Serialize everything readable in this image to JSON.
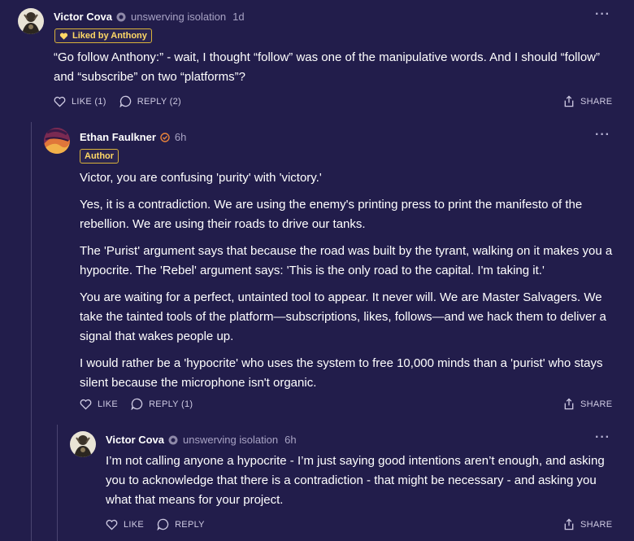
{
  "comments": [
    {
      "author": "Victor Cova",
      "subtitle": "unswerving isolation",
      "time": "1d",
      "badge": "Liked by Anthony",
      "paragraphs": [
        "“Go follow Anthony:” - wait, I thought “follow” was one of the manipulative words. And I should “follow” and “subscribe” on two “platforms”?"
      ],
      "like_label": "LIKE (1)",
      "reply_label": "REPLY (2)",
      "share_label": "SHARE"
    },
    {
      "author": "Ethan Faulkner",
      "time": "6h",
      "badge": "Author",
      "paragraphs": [
        "Victor, you are confusing 'purity' with 'victory.'",
        "Yes, it is a contradiction. We are using the enemy's printing press to print the manifesto of the rebellion. We are using their roads to drive our tanks.",
        "The 'Purist' argument says that because the road was built by the tyrant, walking on it makes you a hypocrite. The 'Rebel' argument says: 'This is the only road to the capital. I'm taking it.'",
        "You are waiting for a perfect, untainted tool to appear. It never will. We are Master Salvagers. We take the tainted tools of the platform—subscriptions, likes, follows—and we hack them to deliver a signal that wakes people up.",
        "I would rather be a 'hypocrite' who uses the system to free 10,000 minds than a 'purist' who stays silent because the microphone isn't organic."
      ],
      "like_label": "LIKE",
      "reply_label": "REPLY (1)",
      "share_label": "SHARE"
    },
    {
      "author": "Victor Cova",
      "subtitle": "unswerving isolation",
      "time": "6h",
      "paragraphs": [
        "I’m not calling anyone a hypocrite - I’m just saying good intentions aren’t enough, and asking you to acknowledge that there is a contradiction - that might be necessary - and asking you what that means for your project."
      ],
      "like_label": "LIKE",
      "reply_label": "REPLY",
      "share_label": "SHARE"
    }
  ],
  "icons": {
    "more": "more-dots-icon",
    "like": "heart-icon",
    "reply": "speech-bubble-icon",
    "share": "share-icon",
    "subscriber": "subscriber-badge-icon",
    "author_check": "author-check-icon"
  },
  "colors": {
    "background": "#221d4b",
    "badge_gold": "#ffd866",
    "author_check": "#e8833a"
  }
}
